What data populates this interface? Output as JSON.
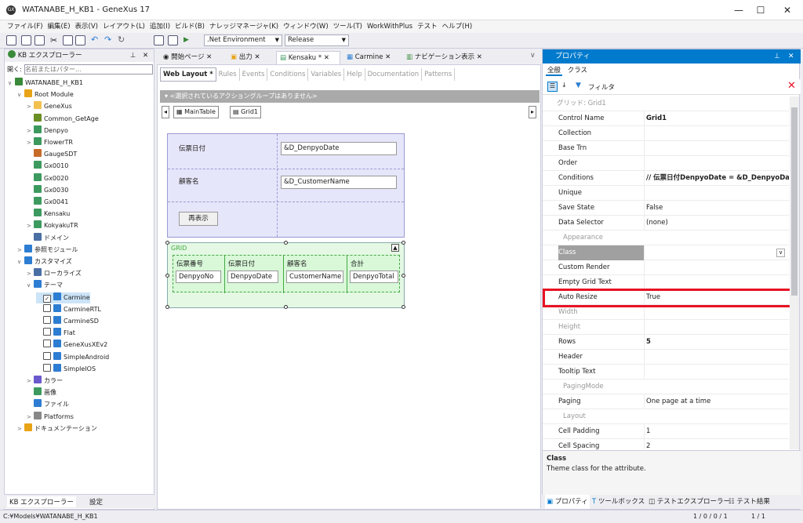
{
  "window": {
    "title": "WATANABE_H_KB1 - GeneXus 17",
    "app_icon": "GX"
  },
  "menu": [
    "ファイル(F)",
    "編集(E)",
    "表示(V)",
    "レイアウト(L)",
    "追加(I)",
    "ビルド(B)",
    "ナレッジマネージャ(K)",
    "ウィンドウ(W)",
    "ツール(T)",
    "WorkWithPlus",
    "テスト",
    "ヘルプ(H)"
  ],
  "toolbar": {
    "environment": ".Net Environment",
    "configuration": "Release"
  },
  "kb_explorer": {
    "title": "KB エクスプローラー",
    "search_label": "開く:",
    "search_placeholder": "名前またはパター...",
    "tree": [
      {
        "label": "WATANABE_H_KB1",
        "indent": 0,
        "exp": "∨",
        "color": "#3a8a3a"
      },
      {
        "label": "Root Module",
        "indent": 1,
        "exp": "∨",
        "color": "#e8a317"
      },
      {
        "label": "GeneXus",
        "indent": 2,
        "exp": ">",
        "color": "#f2c14e"
      },
      {
        "label": "Common_GetAge",
        "indent": 2,
        "exp": "",
        "color": "#6b8e23"
      },
      {
        "label": "Denpyo",
        "indent": 2,
        "exp": ">",
        "color": "#3c9a5f"
      },
      {
        "label": "FlowerTR",
        "indent": 2,
        "exp": ">",
        "color": "#3c9a5f"
      },
      {
        "label": "GaugeSDT",
        "indent": 2,
        "exp": "",
        "color": "#c76b29"
      },
      {
        "label": "Gx0010",
        "indent": 2,
        "exp": "",
        "color": "#3c9a5f"
      },
      {
        "label": "Gx0020",
        "indent": 2,
        "exp": "",
        "color": "#3c9a5f"
      },
      {
        "label": "Gx0030",
        "indent": 2,
        "exp": "",
        "color": "#3c9a5f"
      },
      {
        "label": "Gx0041",
        "indent": 2,
        "exp": "",
        "color": "#3c9a5f"
      },
      {
        "label": "Kensaku",
        "indent": 2,
        "exp": "",
        "color": "#3c9a5f"
      },
      {
        "label": "KokyakuTR",
        "indent": 2,
        "exp": ">",
        "color": "#3c9a5f"
      },
      {
        "label": "ドメイン",
        "indent": 2,
        "exp": "",
        "color": "#4a6fa5"
      },
      {
        "label": "参照モジュール",
        "indent": 1,
        "exp": ">",
        "color": "#2d7dd2"
      },
      {
        "label": "カスタマイズ",
        "indent": 1,
        "exp": "∨",
        "color": "#2d7dd2"
      },
      {
        "label": "ローカライズ",
        "indent": 2,
        "exp": ">",
        "color": "#4a6fa5"
      },
      {
        "label": "テーマ",
        "indent": 2,
        "exp": "∨",
        "color": "#2d7dd2"
      },
      {
        "label": "Carmine",
        "indent": 3,
        "exp": "",
        "color": "#2d7dd2",
        "selected": true
      },
      {
        "label": "CarmineRTL",
        "indent": 3,
        "exp": "",
        "color": "#2d7dd2"
      },
      {
        "label": "CarmineSD",
        "indent": 3,
        "exp": "",
        "color": "#2d7dd2"
      },
      {
        "label": "Flat",
        "indent": 3,
        "exp": "",
        "color": "#2d7dd2"
      },
      {
        "label": "GeneXusXEv2",
        "indent": 3,
        "exp": "",
        "color": "#2d7dd2"
      },
      {
        "label": "SimpleAndroid",
        "indent": 3,
        "exp": "",
        "color": "#2d7dd2"
      },
      {
        "label": "SimpleIOS",
        "indent": 3,
        "exp": "",
        "color": "#2d7dd2"
      },
      {
        "label": "カラー",
        "indent": 2,
        "exp": ">",
        "color": "#6a5acd"
      },
      {
        "label": "画像",
        "indent": 2,
        "exp": "",
        "color": "#3c9a5f"
      },
      {
        "label": "ファイル",
        "indent": 2,
        "exp": "",
        "color": "#2d7dd2"
      },
      {
        "label": "Platforms",
        "indent": 2,
        "exp": ">",
        "color": "#888888"
      },
      {
        "label": "ドキュメンテーション",
        "indent": 1,
        "exp": ">",
        "color": "#e8a317"
      }
    ],
    "bottom_tabs": [
      "KB エクスプローラー",
      "設定"
    ]
  },
  "doc_tabs": [
    {
      "label": "開始ページ",
      "active": false
    },
    {
      "label": "出力",
      "active": false
    },
    {
      "label": "Kensaku *",
      "active": true
    },
    {
      "label": "Carmine",
      "active": false
    },
    {
      "label": "ナビゲーション表示",
      "active": false
    }
  ],
  "editor": {
    "subtabs": [
      "Web Layout *",
      "Rules",
      "Events",
      "Conditions",
      "Variables",
      "Help",
      "Documentation",
      "Patterns"
    ],
    "action_bar": "<選択されているアクショングループはありません>",
    "breadcrumbs": [
      "MainTable",
      "Grid1"
    ],
    "form": {
      "label1": "伝票日付",
      "value1": "&D_DenpyoDate",
      "label2": "顧客名",
      "value2": "&D_CustomerName",
      "button": "再表示"
    },
    "grid": {
      "caption": "GRID",
      "columns": [
        "伝票番号",
        "伝票日付",
        "顧客名",
        "合計"
      ],
      "cells": [
        "DenpyoNo",
        "DenpyoDate",
        "CustomerName",
        "DenpyoTotal"
      ]
    }
  },
  "properties": {
    "title": "プロパティ",
    "tabs": [
      "全般",
      "クラス"
    ],
    "filter_label": "フィルタ",
    "category": "グリッド: Grid1",
    "rows": [
      {
        "name": "Control Name",
        "value": "Grid1",
        "bold": true
      },
      {
        "name": "Collection",
        "value": ""
      },
      {
        "name": "Base Trn",
        "value": ""
      },
      {
        "name": "Order",
        "value": ""
      },
      {
        "name": "Conditions",
        "value": "// 伝票日付DenpyoDate = &D_DenpyoDat...",
        "bold": true
      },
      {
        "name": "Unique",
        "value": ""
      },
      {
        "name": "Save State",
        "value": "False"
      },
      {
        "name": "Data Selector",
        "value": "(none)"
      },
      {
        "name": "Appearance",
        "value": "",
        "cat": true
      },
      {
        "name": "Class",
        "value": "",
        "selected": true
      },
      {
        "name": "Custom Render",
        "value": ""
      },
      {
        "name": "Empty Grid Text",
        "value": ""
      },
      {
        "name": "Auto Resize",
        "value": "True"
      },
      {
        "name": "Width",
        "value": "",
        "dis": true
      },
      {
        "name": "Height",
        "value": "",
        "dis": true
      },
      {
        "name": "Rows",
        "value": "5",
        "bold": true
      },
      {
        "name": "Header",
        "value": ""
      },
      {
        "name": "Tooltip Text",
        "value": ""
      },
      {
        "name": "PagingMode",
        "value": "",
        "cat": true
      },
      {
        "name": "Paging",
        "value": "One page at a time"
      },
      {
        "name": "Layout",
        "value": "",
        "cat": true
      },
      {
        "name": "Cell Padding",
        "value": "1"
      },
      {
        "name": "Cell Spacing",
        "value": "2"
      }
    ],
    "desc_title": "Class",
    "desc_text": "Theme class for the attribute.",
    "bottom_tabs": [
      "プロパティ",
      "ツールボックス",
      "テストエクスプローラー",
      "テスト結果"
    ]
  },
  "status": {
    "path": "C:¥Models¥WATANABE_H_KB1",
    "right1": "1 / 0 / 0 / 1",
    "right2": "1 / 1"
  }
}
